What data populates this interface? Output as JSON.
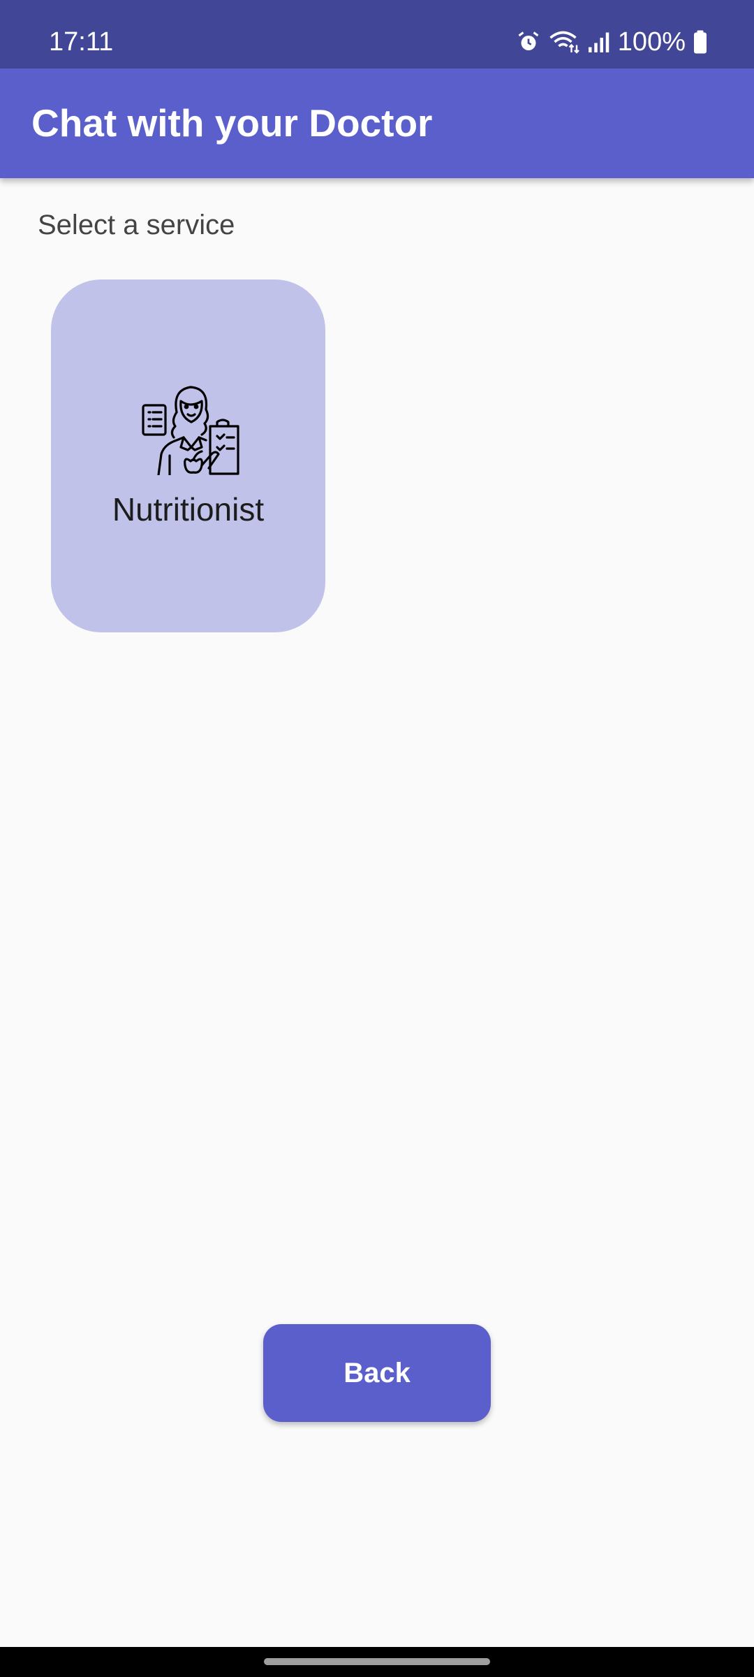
{
  "status_bar": {
    "time": "17:11",
    "battery": "100%",
    "icons": [
      "alarm-icon",
      "wifi-icon",
      "signal-icon",
      "battery-icon"
    ]
  },
  "app_bar": {
    "title": "Chat with your Doctor",
    "color": "#5a5fcb"
  },
  "main": {
    "section_label": "Select a service",
    "services": [
      {
        "label": "Nutritionist",
        "icon": "nutritionist-icon",
        "card_color": "#c0c2ea"
      }
    ],
    "back_label": "Back"
  },
  "colors": {
    "status_bar": "#414796",
    "accent": "#5a5fcb",
    "card": "#c0c2ea",
    "background": "#fafafa"
  }
}
